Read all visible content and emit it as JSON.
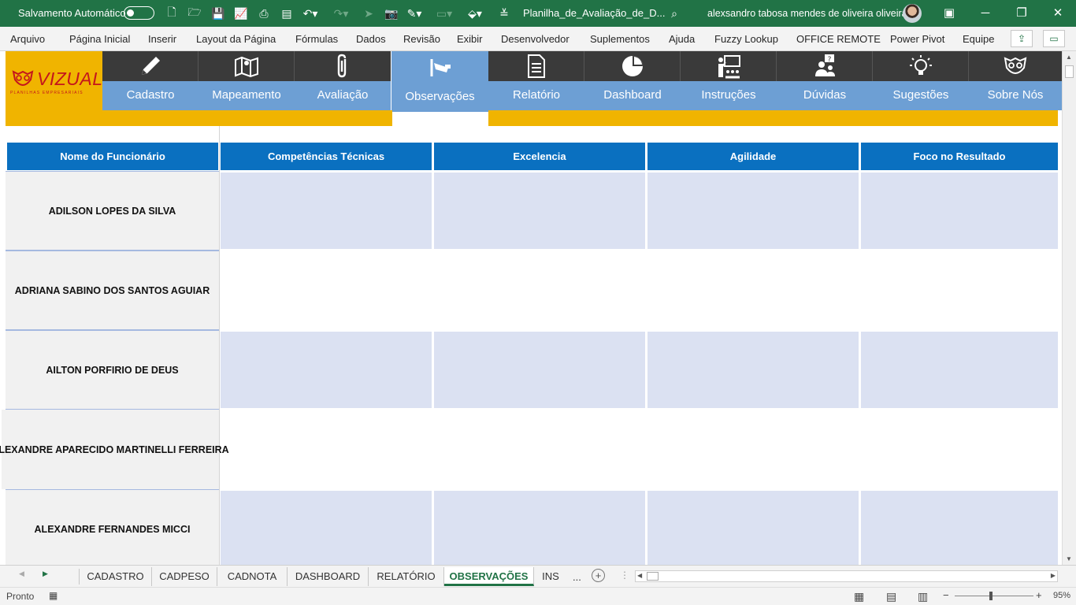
{
  "titlebar": {
    "autosave_label": "Salvamento Automático",
    "doc_title": "Planilha_de_Avaliação_de_D...",
    "user_name": "alexsandro tabosa mendes de oliveira oliveira"
  },
  "menu": [
    "Arquivo",
    "Página Inicial",
    "Inserir",
    "Layout da Página",
    "Fórmulas",
    "Dados",
    "Revisão",
    "Exibir",
    "Desenvolvedor",
    "Suplementos",
    "Ajuda",
    "Fuzzy Lookup",
    "OFFICE REMOTE",
    "Power Pivot",
    "Equipe"
  ],
  "logo": {
    "text": "VIZUAL",
    "sub": "PLANILHAS EMPRESARIAIS"
  },
  "nav_tabs": [
    {
      "label": "Cadastro",
      "icon": "pencil-icon"
    },
    {
      "label": "Mapeamento",
      "icon": "map-icon"
    },
    {
      "label": "Avaliação",
      "icon": "paperclip-icon"
    },
    {
      "label": "Observações",
      "icon": "camera-icon",
      "active": true
    },
    {
      "label": "Relatório",
      "icon": "document-icon"
    },
    {
      "label": "Dashboard",
      "icon": "pie-chart-icon"
    },
    {
      "label": "Instruções",
      "icon": "presentation-icon"
    },
    {
      "label": "Dúvidas",
      "icon": "question-users-icon"
    },
    {
      "label": "Sugestões",
      "icon": "lightbulb-icon"
    },
    {
      "label": "Sobre Nós",
      "icon": "owl-icon"
    }
  ],
  "table": {
    "headers": [
      "Nome do Funcionário",
      "Competências Técnicas",
      "Excelencia",
      "Agilidade",
      "Foco no Resultado"
    ],
    "rows": [
      "ADILSON LOPES DA SILVA",
      "ADRIANA SABINO DOS SANTOS AGUIAR",
      "AILTON PORFIRIO DE DEUS",
      "ALEXANDRE APARECIDO MARTINELLI FERREIRA",
      "ALEXANDRE FERNANDES MICCI"
    ]
  },
  "sheet_tabs": [
    "CADASTRO",
    "CADPESO",
    "CADNOTA",
    "DASHBOARD",
    "RELATÓRIO",
    "OBSERVAÇÕES",
    "INS"
  ],
  "active_sheet_tab": "OBSERVAÇÕES",
  "sheet_tabs_more": "...",
  "status": {
    "ready": "Pronto",
    "zoom": "95%"
  },
  "colors": {
    "excel_green": "#217346",
    "nav_dark": "#3a3a3a",
    "nav_blue": "#6d9fd4",
    "header_blue": "#0a70c0",
    "logo_yellow": "#f0b400",
    "band_blue": "#dbe1f2"
  }
}
